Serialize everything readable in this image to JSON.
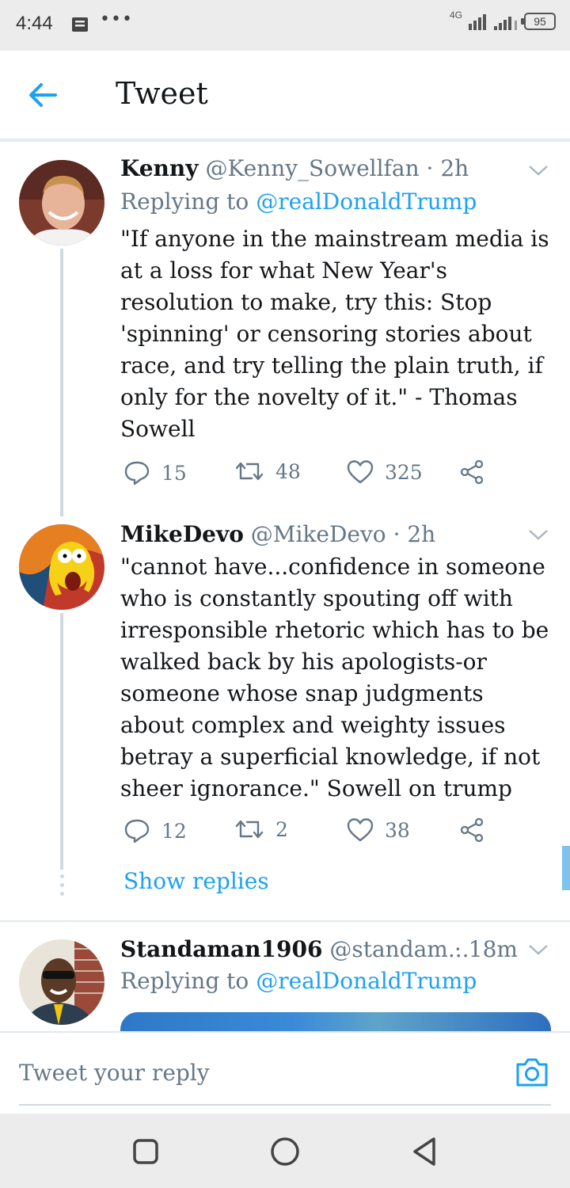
{
  "status_bar": {
    "time": "4:44",
    "dots": "•••",
    "network": "4G",
    "battery": "95"
  },
  "header": {
    "title": "Tweet"
  },
  "tweets": [
    {
      "name": "Kenny",
      "handle": "@Kenny_Sowellfan",
      "time": "· 2h",
      "replying_prefix": "Replying to",
      "replying_to": "@realDonaldTrump",
      "body": "\"If anyone in the mainstream media is at a loss for what New Year's resolution to make, try this: Stop 'spinning' or censoring stories about race, and try telling the plain truth, if only for the novelty of it.\" - Thomas Sowell",
      "replies": "15",
      "retweets": "48",
      "likes": "325"
    },
    {
      "name": "MikeDevo",
      "handle": "@MikeDevo",
      "time": "· 2h",
      "body": "\"cannot have...confidence in someone who is constantly spouting off with irresponsible rhetoric which has to be walked back by his apologists-or someone whose snap judgments about complex and weighty issues betray a superficial knowledge, if not sheer ignorance.\" Sowell on trump",
      "replies": "12",
      "retweets": "2",
      "likes": "38",
      "show_replies": "Show replies"
    },
    {
      "name": "Standaman1906",
      "handle": "@standam...",
      "time": "· 18m",
      "replying_prefix": "Replying to",
      "replying_to": "@realDonaldTrump"
    }
  ],
  "reply_bar": {
    "placeholder": "Tweet your reply"
  },
  "colors": {
    "accent": "#1da1f2",
    "secondary_text": "#657786",
    "thread_line": "#cfd9de"
  },
  "icons": [
    "back-arrow-icon",
    "chevron-down-icon",
    "reply-icon",
    "retweet-icon",
    "like-icon",
    "share-icon",
    "camera-icon",
    "nav-recents-icon",
    "nav-home-icon",
    "nav-back-icon"
  ]
}
